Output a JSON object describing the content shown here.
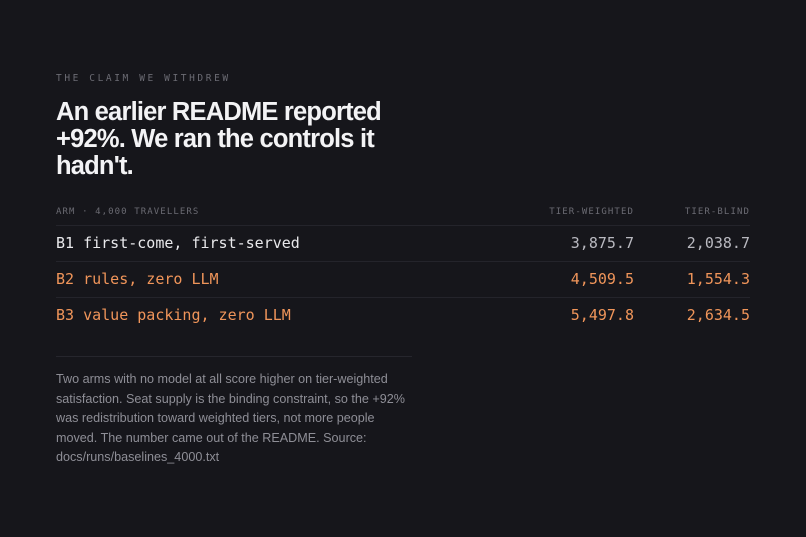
{
  "eyebrow": "THE CLAIM WE WITHDREW",
  "headline": "An earlier README reported +92%. We ran the controls it hadn't.",
  "table": {
    "headers": {
      "arm": "ARM · 4,000 TRAVELLERS",
      "tier_weighted": "TIER-WEIGHTED",
      "tier_blind": "TIER-BLIND"
    },
    "rows": [
      {
        "arm": "B1 first-come, first-served",
        "tier_weighted": "3,875.7",
        "tier_blind": "2,038.7"
      },
      {
        "arm": "B2 rules, zero LLM",
        "tier_weighted": "4,509.5",
        "tier_blind": "1,554.3"
      },
      {
        "arm": "B3 value packing, zero LLM",
        "tier_weighted": "5,497.8",
        "tier_blind": "2,634.5"
      }
    ]
  },
  "note": "Two arms with no model at all score higher on tier-weighted satisfaction. Seat supply is the binding constraint, so the +92% was redistribution toward weighted tiers, not more people moved. The number came out of the README. Source: docs/runs/baselines_4000.txt",
  "colors": {
    "background": "#16161b",
    "accent": "#f0955a",
    "text": "#f3f3f5",
    "muted": "#6b6b73"
  }
}
